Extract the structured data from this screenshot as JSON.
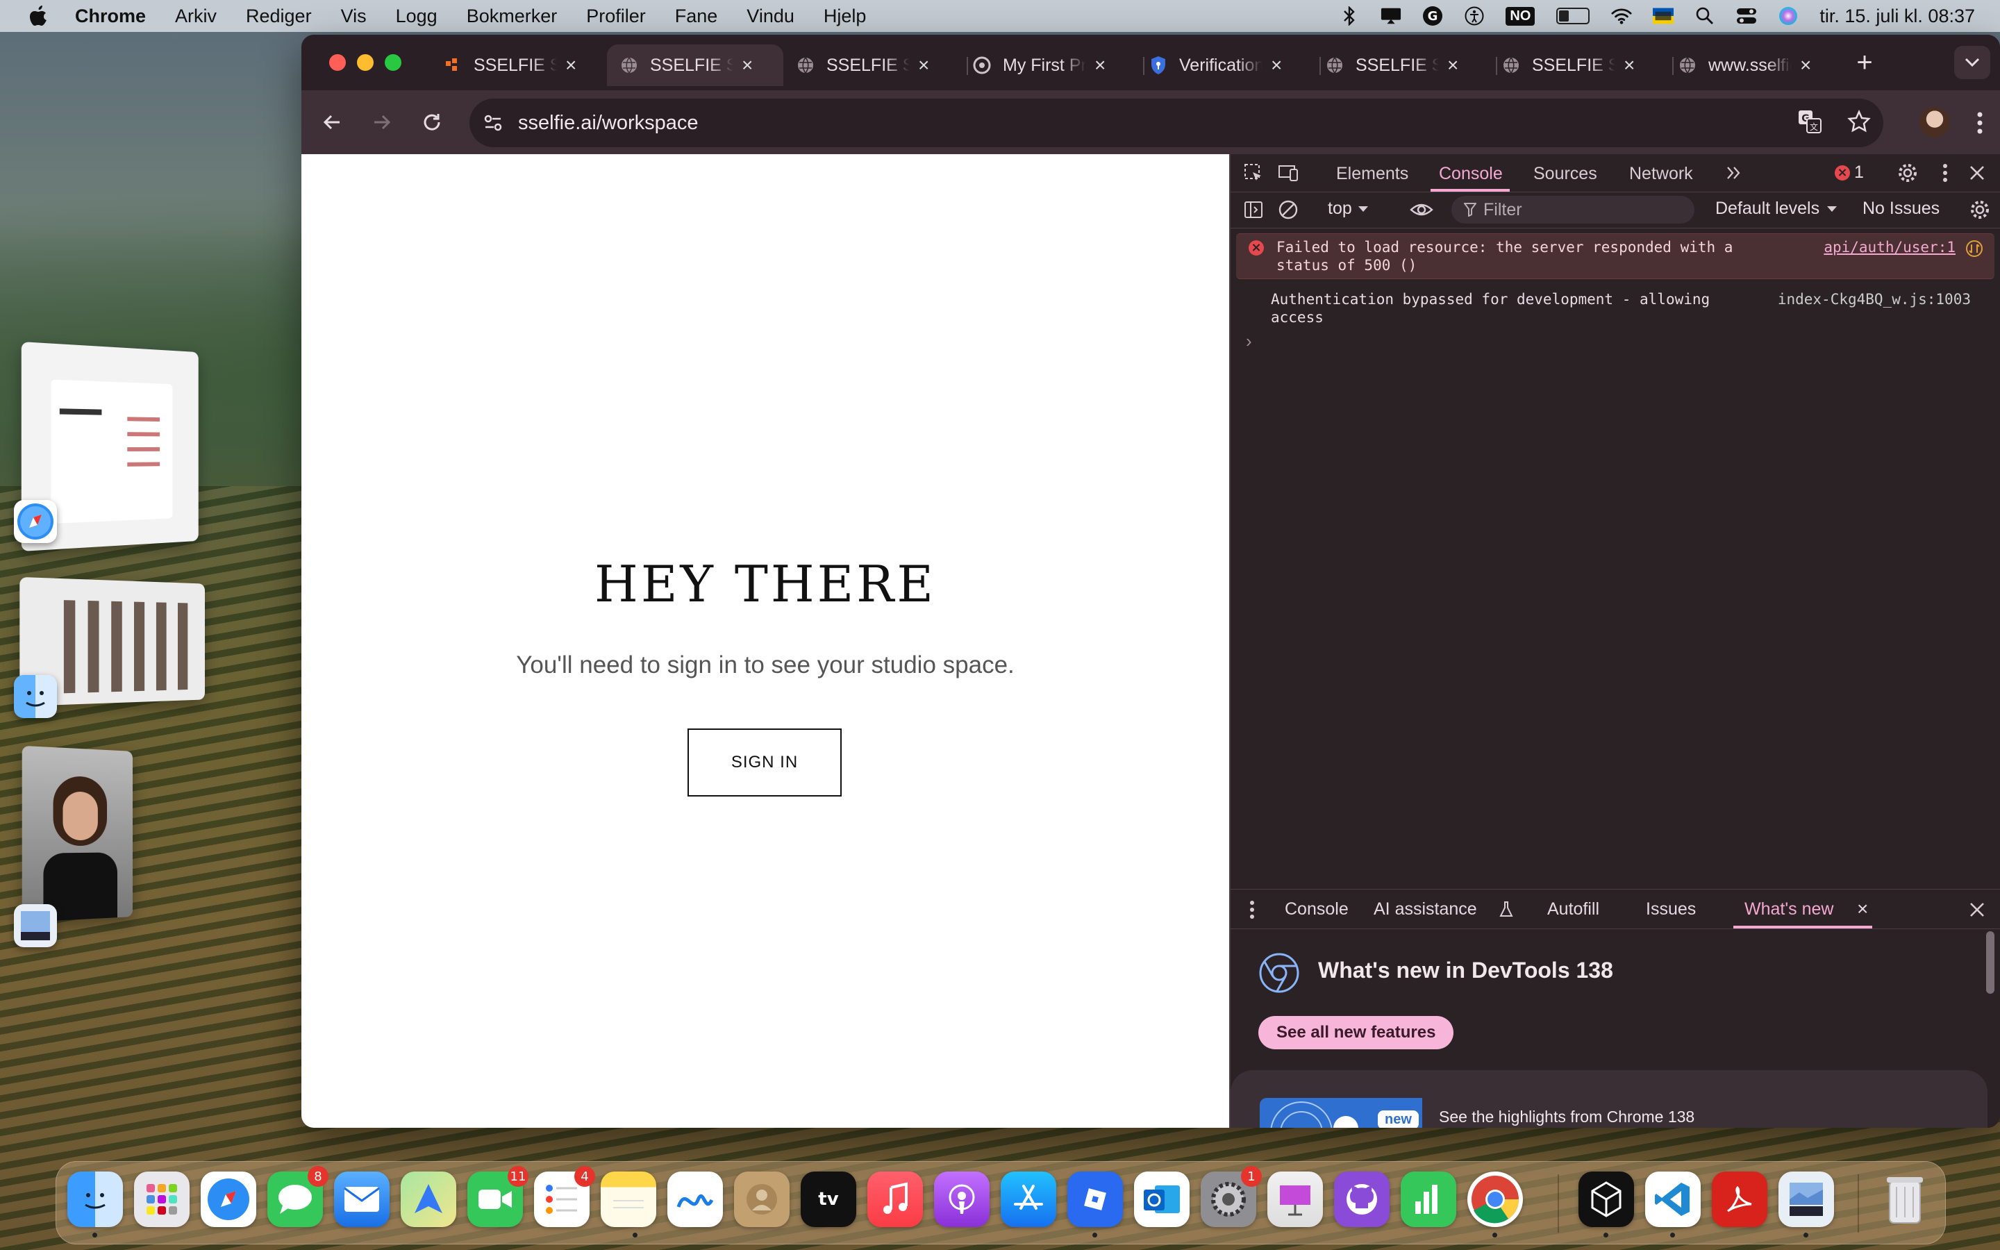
{
  "menubar": {
    "app": "Chrome",
    "items": [
      "Arkiv",
      "Rediger",
      "Vis",
      "Logg",
      "Bokmerker",
      "Profiler",
      "Fane",
      "Vindu",
      "Hjelp"
    ],
    "input_source": "NO",
    "clock": "tir. 15. juli kl. 08:37"
  },
  "browser": {
    "tabs": [
      {
        "title": "SSELFIE Studio",
        "icon": "orange-logo-icon"
      },
      {
        "title": "SSELFIE Studio",
        "icon": "globe-icon",
        "active": true
      },
      {
        "title": "SSELFIE Studio",
        "icon": "globe-icon"
      },
      {
        "title": "My First Project",
        "icon": "github-icon"
      },
      {
        "title": "Verification",
        "icon": "shield-icon"
      },
      {
        "title": "SSELFIE Studio",
        "icon": "globe-icon"
      },
      {
        "title": "SSELFIE Studio",
        "icon": "globe-icon"
      },
      {
        "title": "www.sselfie.ai",
        "icon": "globe-icon"
      }
    ],
    "url": "sselfie.ai/workspace"
  },
  "page": {
    "title": "HEY THERE",
    "subtitle": "You'll need to sign in to see your studio space.",
    "sign_in_label": "SIGN IN"
  },
  "devtools": {
    "tabs": [
      "Elements",
      "Console",
      "Sources",
      "Network"
    ],
    "active_tab": "Console",
    "error_count": "1",
    "context": "top",
    "filter_placeholder": "Filter",
    "levels": "Default levels",
    "issues": "No Issues",
    "messages": [
      {
        "type": "error",
        "text": "Failed to load resource: the server responded with a status of 500 ()",
        "source": "api/auth/user:1"
      },
      {
        "type": "log",
        "text": "Authentication bypassed for development - allowing access",
        "source": "index-Ckg4BQ_w.js:1003"
      }
    ],
    "drawer": {
      "tabs": [
        "Console",
        "AI assistance",
        "Autofill",
        "Issues",
        "What's new"
      ],
      "active_tab": "What's new",
      "whatsnew_title": "What's new in DevTools 138",
      "see_all_label": "See all new features",
      "new_badge": "new",
      "highlight_text": "See the highlights from Chrome 138"
    }
  },
  "dock": {
    "badges": {
      "messages": "8",
      "facetime": "11",
      "reminders": "4",
      "settings": "1"
    }
  },
  "colors": {
    "accent_pink": "#f5a8d0",
    "devtools_bg": "#2b2226",
    "error_red": "#e5484d"
  }
}
